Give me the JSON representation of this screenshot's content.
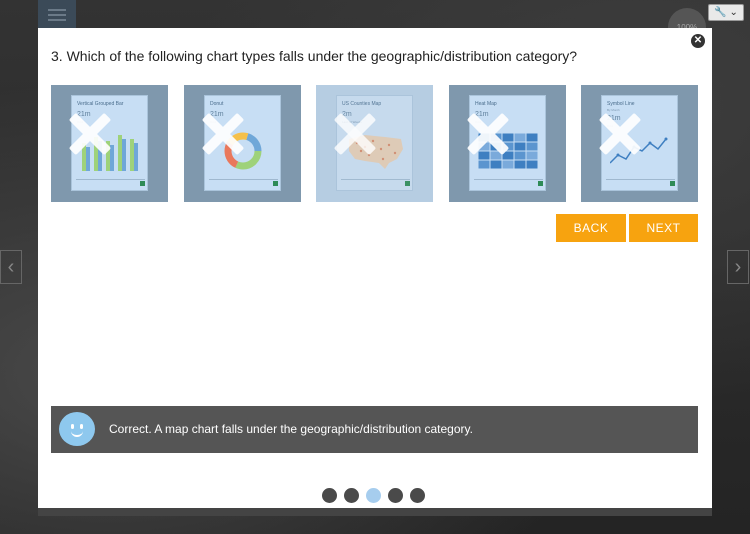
{
  "background": {
    "badge_text": "100%",
    "tools_icon": "wrench-icon",
    "left_arrow": "‹",
    "right_arrow": "›"
  },
  "modal": {
    "question": "3. Which of the following chart types falls under the geographic/distribution category?",
    "close_icon": "close-icon",
    "cards": [
      {
        "title": "Vertical Grouped Bar",
        "value": "21m",
        "sub": "Total",
        "selected": false
      },
      {
        "title": "Donut",
        "value": "21m",
        "sub": "Total",
        "selected": false
      },
      {
        "title": "US Counties Map",
        "value": "2m",
        "sub": "Last 12 Weeks",
        "selected": true
      },
      {
        "title": "Heat Map",
        "value": "21m",
        "sub": "Total",
        "selected": false
      },
      {
        "title": "Symbol Line",
        "subtitle": "By Month",
        "value": "21m",
        "sub": "Total",
        "selected": false
      }
    ],
    "back_label": "BACK",
    "next_label": "NEXT",
    "feedback_text": "Correct. A map chart falls under the geographic/distribution category.",
    "pagination": {
      "total": 5,
      "current": 3
    }
  },
  "colors": {
    "accent": "#f7a30f",
    "card_bg": "#7f98ad",
    "feedback_bg": "#555555",
    "dot_active": "#a6cdee"
  }
}
